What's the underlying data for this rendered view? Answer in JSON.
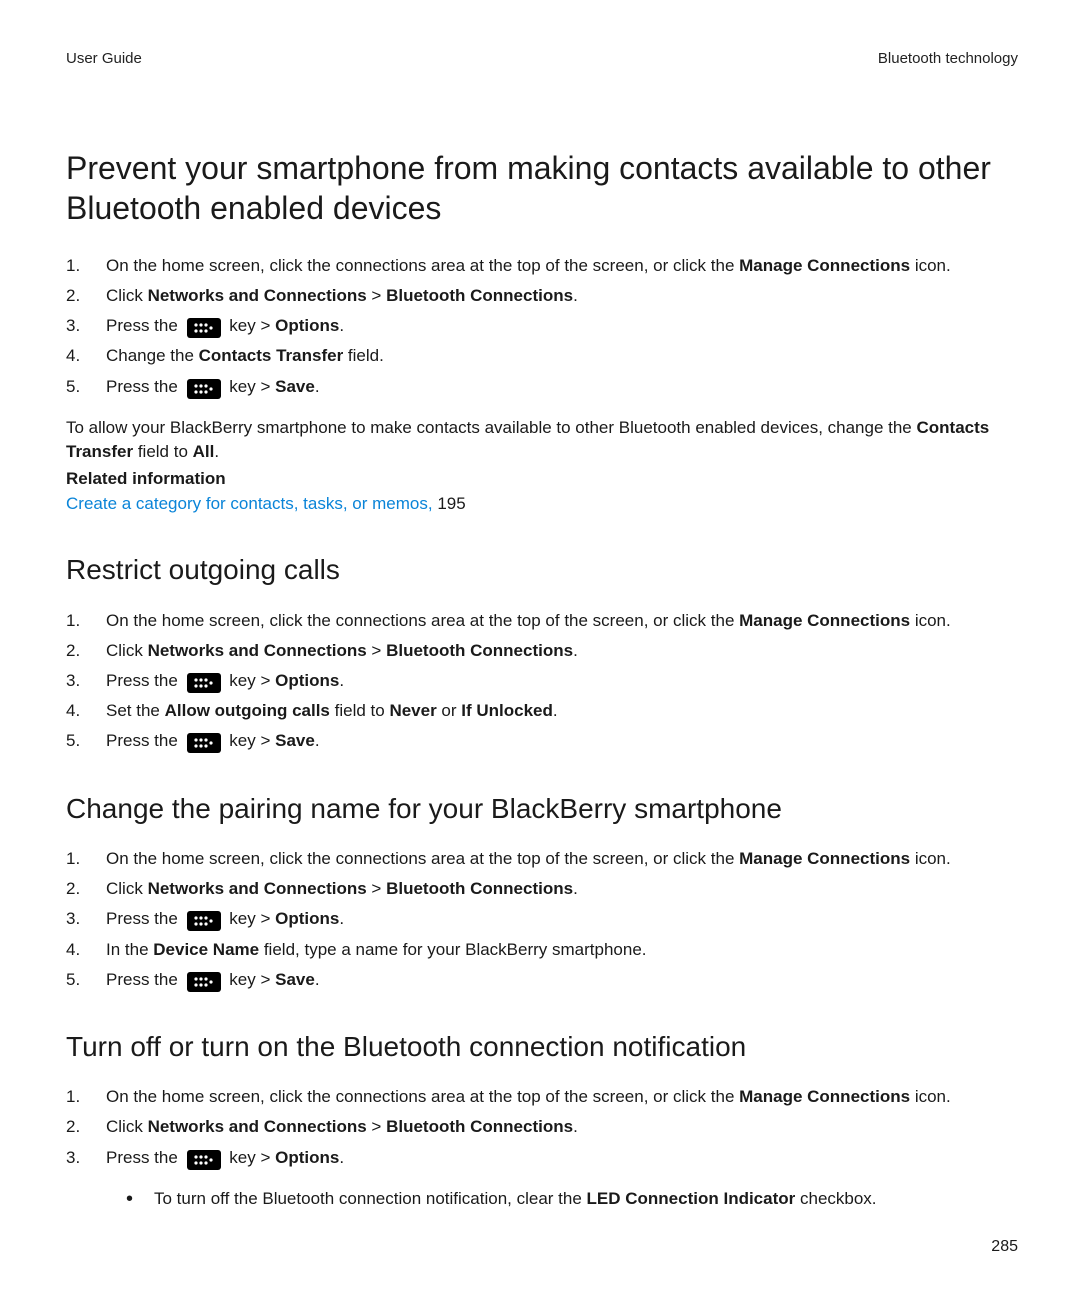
{
  "header": {
    "left": "User Guide",
    "right": "Bluetooth technology"
  },
  "page_number": "285",
  "key_icon_name": "blackberry-key-icon",
  "section1": {
    "title": "Prevent your smartphone from making contacts available to other Bluetooth enabled devices",
    "steps": {
      "s1_a": "On the home screen, click the connections area at the top of the screen, or click the ",
      "s1_b": "Manage Connections",
      "s1_c": " icon.",
      "s2_a": "Click ",
      "s2_b": "Networks and Connections",
      "s2_gt": " > ",
      "s2_c": "Bluetooth Connections",
      "s2_d": ".",
      "s3_a": "Press the ",
      "s3_key": " key > ",
      "s3_b": "Options",
      "s3_c": ".",
      "s4_a": "Change the ",
      "s4_b": "Contacts Transfer",
      "s4_c": " field.",
      "s5_a": "Press the ",
      "s5_key": " key > ",
      "s5_b": "Save",
      "s5_c": "."
    },
    "note_a": "To allow your BlackBerry smartphone to make contacts available to other Bluetooth enabled devices, change the ",
    "note_b": "Contacts Transfer",
    "note_c": " field to ",
    "note_d": "All",
    "note_e": ".",
    "related_title": "Related information",
    "related_link": "Create a category for contacts, tasks, or memos, ",
    "related_page": "195"
  },
  "section2": {
    "title": "Restrict outgoing calls",
    "steps": {
      "s1_a": "On the home screen, click the connections area at the top of the screen, or click the ",
      "s1_b": "Manage Connections",
      "s1_c": " icon.",
      "s2_a": "Click ",
      "s2_b": "Networks and Connections",
      "s2_gt": " > ",
      "s2_c": "Bluetooth Connections",
      "s2_d": ".",
      "s3_a": "Press the ",
      "s3_key": " key > ",
      "s3_b": "Options",
      "s3_c": ".",
      "s4_a": "Set the ",
      "s4_b": "Allow outgoing calls",
      "s4_c": " field to ",
      "s4_d": "Never",
      "s4_e": " or ",
      "s4_f": "If Unlocked",
      "s4_g": ".",
      "s5_a": "Press the ",
      "s5_key": " key > ",
      "s5_b": "Save",
      "s5_c": "."
    }
  },
  "section3": {
    "title": "Change the pairing name for your BlackBerry smartphone",
    "steps": {
      "s1_a": "On the home screen, click the connections area at the top of the screen, or click the ",
      "s1_b": "Manage Connections",
      "s1_c": " icon.",
      "s2_a": "Click ",
      "s2_b": "Networks and Connections",
      "s2_gt": " > ",
      "s2_c": "Bluetooth Connections",
      "s2_d": ".",
      "s3_a": "Press the ",
      "s3_key": " key > ",
      "s3_b": "Options",
      "s3_c": ".",
      "s4_a": "In the ",
      "s4_b": "Device Name",
      "s4_c": " field, type a name for your BlackBerry smartphone.",
      "s5_a": "Press the ",
      "s5_key": " key > ",
      "s5_b": "Save",
      "s5_c": "."
    }
  },
  "section4": {
    "title": "Turn off or turn on the Bluetooth connection notification",
    "steps": {
      "s1_a": "On the home screen, click the connections area at the top of the screen, or click the ",
      "s1_b": "Manage Connections",
      "s1_c": " icon.",
      "s2_a": "Click ",
      "s2_b": "Networks and Connections",
      "s2_gt": " > ",
      "s2_c": "Bluetooth Connections",
      "s2_d": ".",
      "s3_a": "Press the ",
      "s3_key": " key > ",
      "s3_b": "Options",
      "s3_c": "."
    },
    "bullets": {
      "b1_a": "To turn off the Bluetooth connection notification, clear the ",
      "b1_b": "LED Connection Indicator",
      "b1_c": " checkbox."
    }
  }
}
